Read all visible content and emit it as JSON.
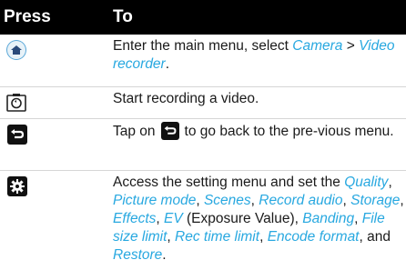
{
  "header": {
    "press": "Press",
    "to": "To"
  },
  "icons": {
    "home": "home-icon",
    "camera": "camera-switch-icon",
    "back": "back-arrow-icon",
    "settings": "gear-icon"
  },
  "rows": [
    {
      "lead": "Enter the main menu, select ",
      "link1": "Camera",
      "mid": " > ",
      "link2": "Video recorder",
      "end": "."
    },
    {
      "text": "Start recording a video."
    },
    {
      "before": "Tap on",
      "after": "to go back to the pre-vious menu."
    },
    {
      "t0": "Access the setting menu and set the ",
      "quality": "Quality",
      "s1": ", ",
      "picture_mode": "Picture mode",
      "s2": ", ",
      "scenes": "Scenes",
      "s3": ", ",
      "record_audio": "Record audio",
      "s4": ", ",
      "storage": "Storage",
      "s5": ", ",
      "effects": "Effects",
      "s6": ", ",
      "ev": "EV",
      "s7": " (Exposure Value), ",
      "banding": "Banding",
      "s8": ", ",
      "file_size": "File size limit",
      "s9": ", ",
      "rec_time": "Rec time limit",
      "s10": ", ",
      "encode": "Encode format",
      "s11": ", and ",
      "restore": "Restore",
      "s12": "."
    }
  ]
}
